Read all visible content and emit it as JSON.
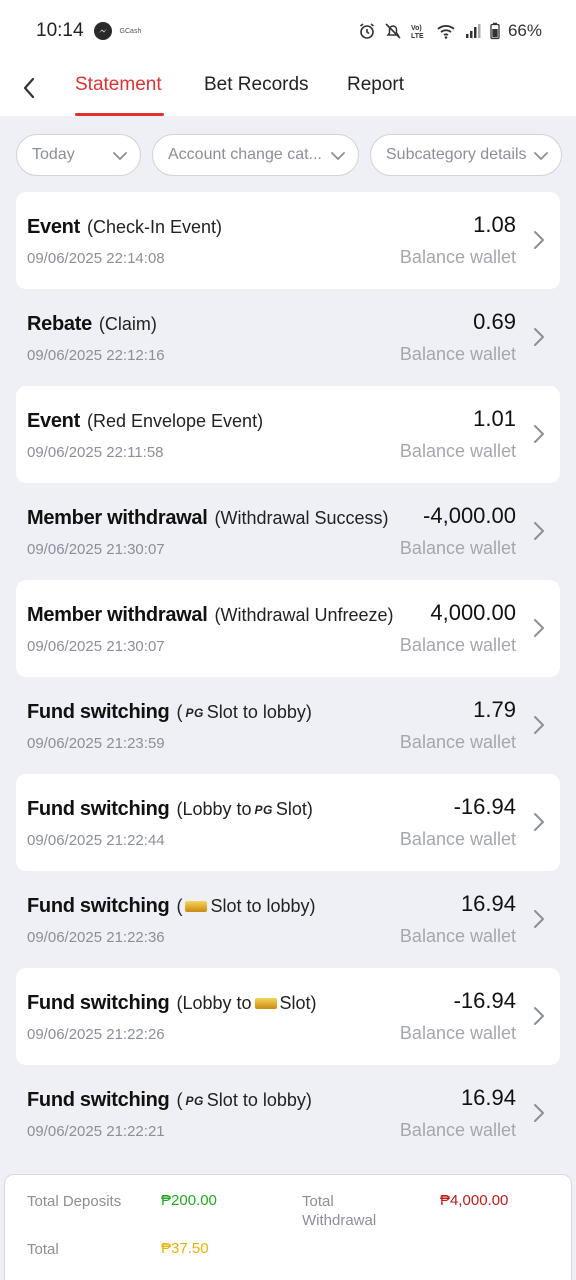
{
  "status": {
    "time": "10:14",
    "gcash": "GCash",
    "battery": "66%"
  },
  "tabs": [
    {
      "label": "Statement",
      "active": true
    },
    {
      "label": "Bet Records",
      "active": false
    },
    {
      "label": "Report",
      "active": false
    }
  ],
  "filters": [
    {
      "label": "Today"
    },
    {
      "label": "Account change cat..."
    },
    {
      "label": "Subcategory details"
    }
  ],
  "records": [
    {
      "title": "Event",
      "detail": "(Check-In Event)",
      "time": "09/06/2025 22:14:08",
      "amount": "1.08",
      "wallet": "Balance wallet"
    },
    {
      "title": "Rebate",
      "detail": "(Claim)",
      "time": "09/06/2025 22:12:16",
      "amount": "0.69",
      "wallet": "Balance wallet"
    },
    {
      "title": "Event",
      "detail": "(Red Envelope Event)",
      "time": "09/06/2025 22:11:58",
      "amount": "1.01",
      "wallet": "Balance wallet"
    },
    {
      "title": "Member withdrawal",
      "detail": "(Withdrawal Success)",
      "time": "09/06/2025 21:30:07",
      "amount": "-4,000.00",
      "wallet": "Balance wallet"
    },
    {
      "title": "Member withdrawal",
      "detail": "(Withdrawal Unfreeze)",
      "time": "09/06/2025 21:30:07",
      "amount": "4,000.00",
      "wallet": "Balance wallet"
    },
    {
      "title": "Fund switching",
      "detail_pre": "(",
      "detail_post": "Slot to lobby)",
      "logo": "PG",
      "time": "09/06/2025 21:23:59",
      "amount": "1.79",
      "wallet": "Balance wallet"
    },
    {
      "title": "Fund switching",
      "detail_pre": "(Lobby to ",
      "detail_post": "Slot)",
      "logo": "PG",
      "time": "09/06/2025 21:22:44",
      "amount": "-16.94",
      "wallet": "Balance wallet"
    },
    {
      "title": "Fund switching",
      "detail_pre": "(",
      "detail_post": "Slot to lobby)",
      "logo": "JILI",
      "time": "09/06/2025 21:22:36",
      "amount": "16.94",
      "wallet": "Balance wallet"
    },
    {
      "title": "Fund switching",
      "detail_pre": "(Lobby to ",
      "detail_post": "Slot)",
      "logo": "JILI",
      "time": "09/06/2025 21:22:26",
      "amount": "-16.94",
      "wallet": "Balance wallet"
    },
    {
      "title": "Fund switching",
      "detail_pre": "(",
      "detail_post": "Slot to lobby)",
      "logo": "PG",
      "time": "09/06/2025 21:22:21",
      "amount": "16.94",
      "wallet": "Balance wallet"
    }
  ],
  "summary": {
    "deposits_label": "Total Deposits",
    "deposits_value": "₱200.00",
    "withdrawal_label_1": "Total",
    "withdrawal_label_2": "Withdrawal",
    "withdrawal_value": "₱4,000.00",
    "total_label": "Total",
    "total_value": "₱37.50"
  },
  "colors": {
    "accent": "#e03131",
    "positive": "#22a822",
    "negative": "#c41a1a",
    "total": "#e9b400"
  },
  "icons": {
    "back": "chevron-left-icon",
    "filter_chevron": "chevron-down-icon",
    "row_chevron": "chevron-right-icon"
  }
}
